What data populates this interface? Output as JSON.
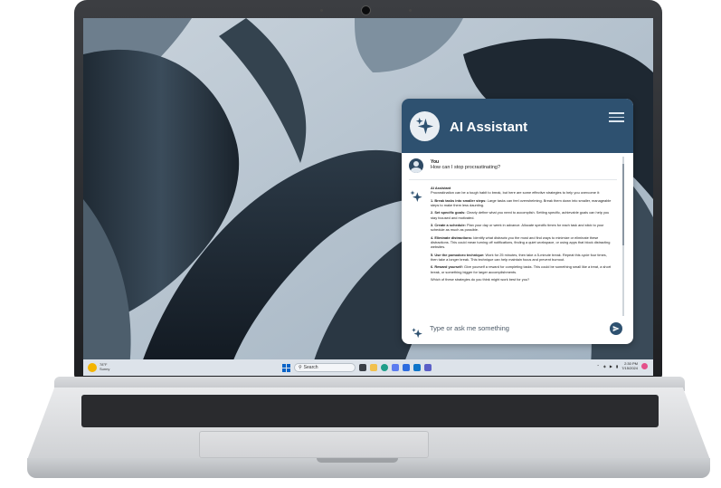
{
  "panel": {
    "title": "AI Assistant",
    "input_placeholder": "Type or ask me something"
  },
  "conversation": {
    "user": {
      "name": "You",
      "message": "How can I stop procrastinating?"
    },
    "assistant": {
      "name": "AI Assistant",
      "intro": "Procrastination can be a tough habit to break, but here are some effective strategies to help you overcome it:",
      "tips": [
        {
          "title": "1. Break tasks into smaller steps:",
          "text": "Large tasks can feel overwhelming. Break them down into smaller, manageable steps to make them less daunting."
        },
        {
          "title": "2. Set specific goals:",
          "text": "Clearly define what you need to accomplish. Setting specific, achievable goals can help you stay focused and motivated."
        },
        {
          "title": "3. Create a schedule:",
          "text": "Plan your day or week in advance. Allocate specific times for each task and stick to your schedule as much as possible."
        },
        {
          "title": "4. Eliminate distractions:",
          "text": "Identify what distracts you the most and find ways to minimize or eliminate these distractions. This could mean turning off notifications, finding a quiet workspace, or using apps that block distracting websites."
        },
        {
          "title": "5. Use the pomodoro technique:",
          "text": "Work for 25 minutes, then take a 5-minute break. Repeat this cycle four times, then take a longer break. This technique can help maintain focus and prevent burnout."
        },
        {
          "title": "6. Reward yourself:",
          "text": "Give yourself a reward for completing tasks. This could be something small like a treat, a short break, or something bigger for larger accomplishments."
        }
      ],
      "closing": "Which of these strategies do you think might work best for you?"
    }
  },
  "taskbar": {
    "weather_temp": "78°F",
    "weather_desc": "Sunny",
    "search_label": "Search",
    "time": "2:30 PM",
    "date": "7/15/2024"
  },
  "colors": {
    "panel_header": "#2e5170",
    "accent": "#2e5170",
    "taskbar": "#dde3ea"
  }
}
